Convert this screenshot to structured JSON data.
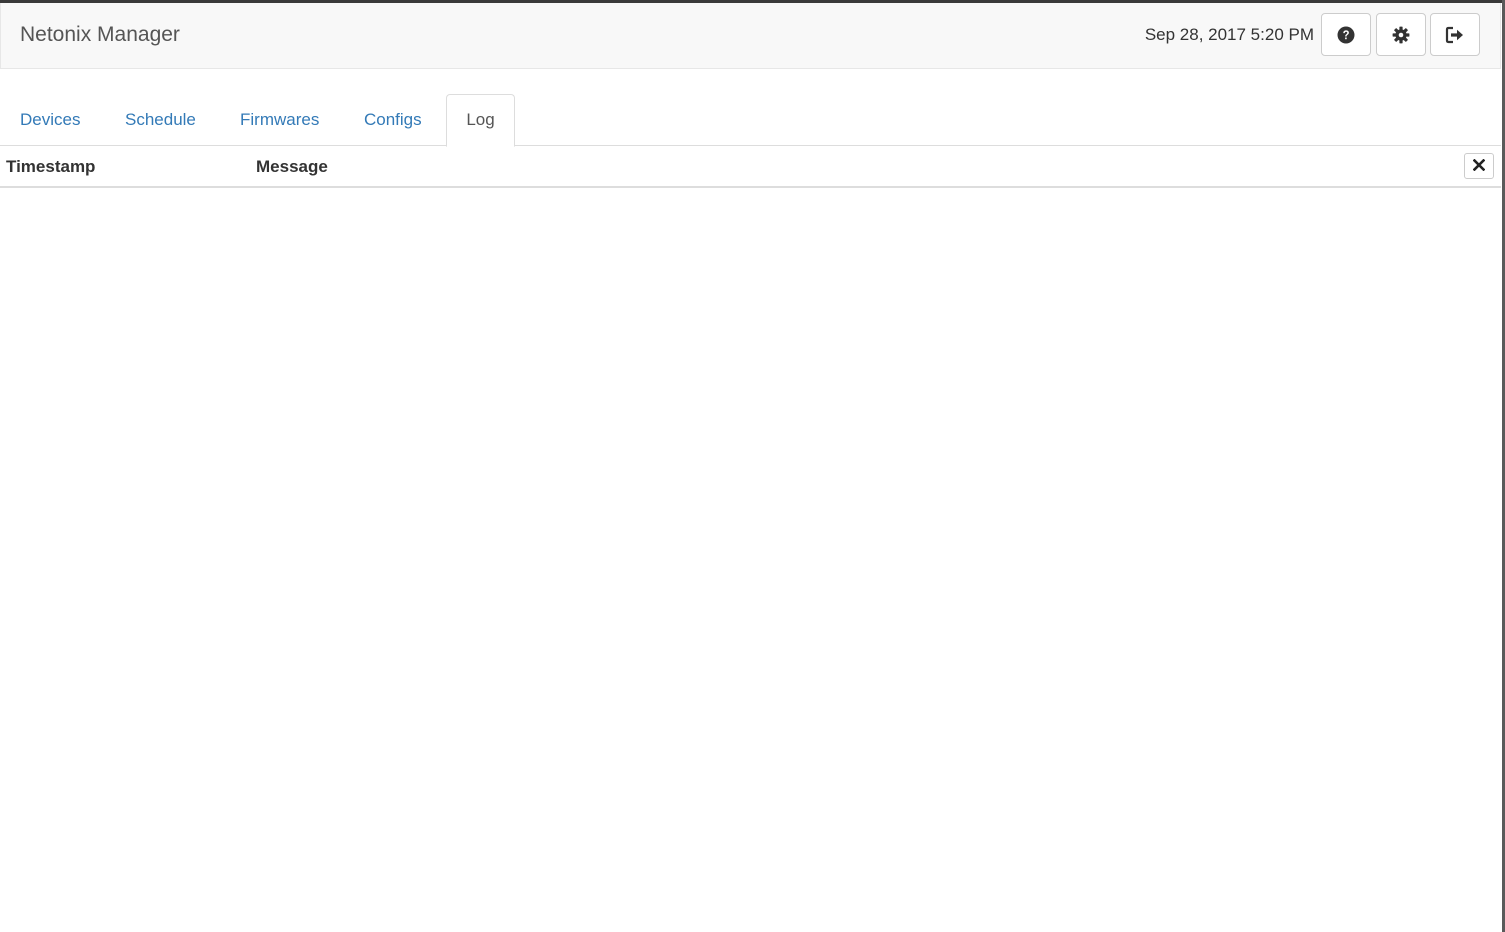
{
  "app": {
    "title": "Netonix Manager",
    "datetime": "Sep 28, 2017 5:20 PM"
  },
  "toolbar": {
    "help_icon": "question-circle-icon",
    "settings_icon": "gear-icon",
    "logout_icon": "sign-out-icon"
  },
  "tabs": [
    {
      "label": "Devices",
      "active": false
    },
    {
      "label": "Schedule",
      "active": false
    },
    {
      "label": "Firmwares",
      "active": false
    },
    {
      "label": "Configs",
      "active": false
    },
    {
      "label": "Log",
      "active": true
    }
  ],
  "log": {
    "columns": [
      "Timestamp",
      "Message"
    ],
    "clear_icon": "close-icon",
    "rows": []
  },
  "colors": {
    "link": "#337ab7",
    "navbar_bg": "#f8f8f8",
    "border": "#dddddd",
    "text": "#333333"
  }
}
